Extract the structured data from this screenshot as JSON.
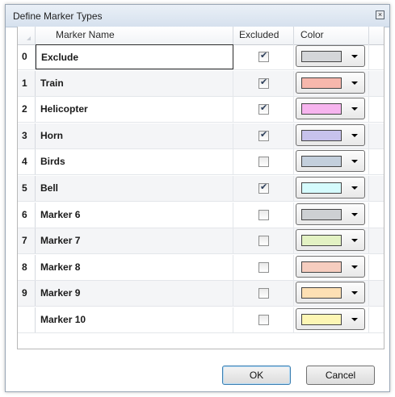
{
  "dialog": {
    "title": "Define Marker Types"
  },
  "grid": {
    "headers": {
      "name": "Marker Name",
      "excluded": "Excluded",
      "color": "Color"
    },
    "rows": [
      {
        "index": "0",
        "name": "Exclude",
        "excluded": true,
        "color": "#d4d6d9"
      },
      {
        "index": "1",
        "name": "Train",
        "excluded": true,
        "color": "#f7b7ac"
      },
      {
        "index": "2",
        "name": "Helicopter",
        "excluded": true,
        "color": "#f6b4ee"
      },
      {
        "index": "3",
        "name": "Horn",
        "excluded": true,
        "color": "#c7c2ec"
      },
      {
        "index": "4",
        "name": "Birds",
        "excluded": false,
        "color": "#c3cfdc"
      },
      {
        "index": "5",
        "name": "Bell",
        "excluded": true,
        "color": "#d5fbfd"
      },
      {
        "index": "6",
        "name": "Marker 6",
        "excluded": false,
        "color": "#cdd0d3"
      },
      {
        "index": "7",
        "name": "Marker 7",
        "excluded": false,
        "color": "#e3f2c3"
      },
      {
        "index": "8",
        "name": "Marker 8",
        "excluded": false,
        "color": "#f6cdbf"
      },
      {
        "index": "9",
        "name": "Marker 9",
        "excluded": false,
        "color": "#fde0b4"
      },
      {
        "index": "",
        "name": "Marker 10",
        "excluded": false,
        "color": "#fdf6b4"
      }
    ]
  },
  "buttons": {
    "ok": "OK",
    "cancel": "Cancel"
  },
  "icons": {
    "close": "close-icon",
    "check": "checkmark-icon",
    "dropdown": "chevron-down-icon"
  }
}
